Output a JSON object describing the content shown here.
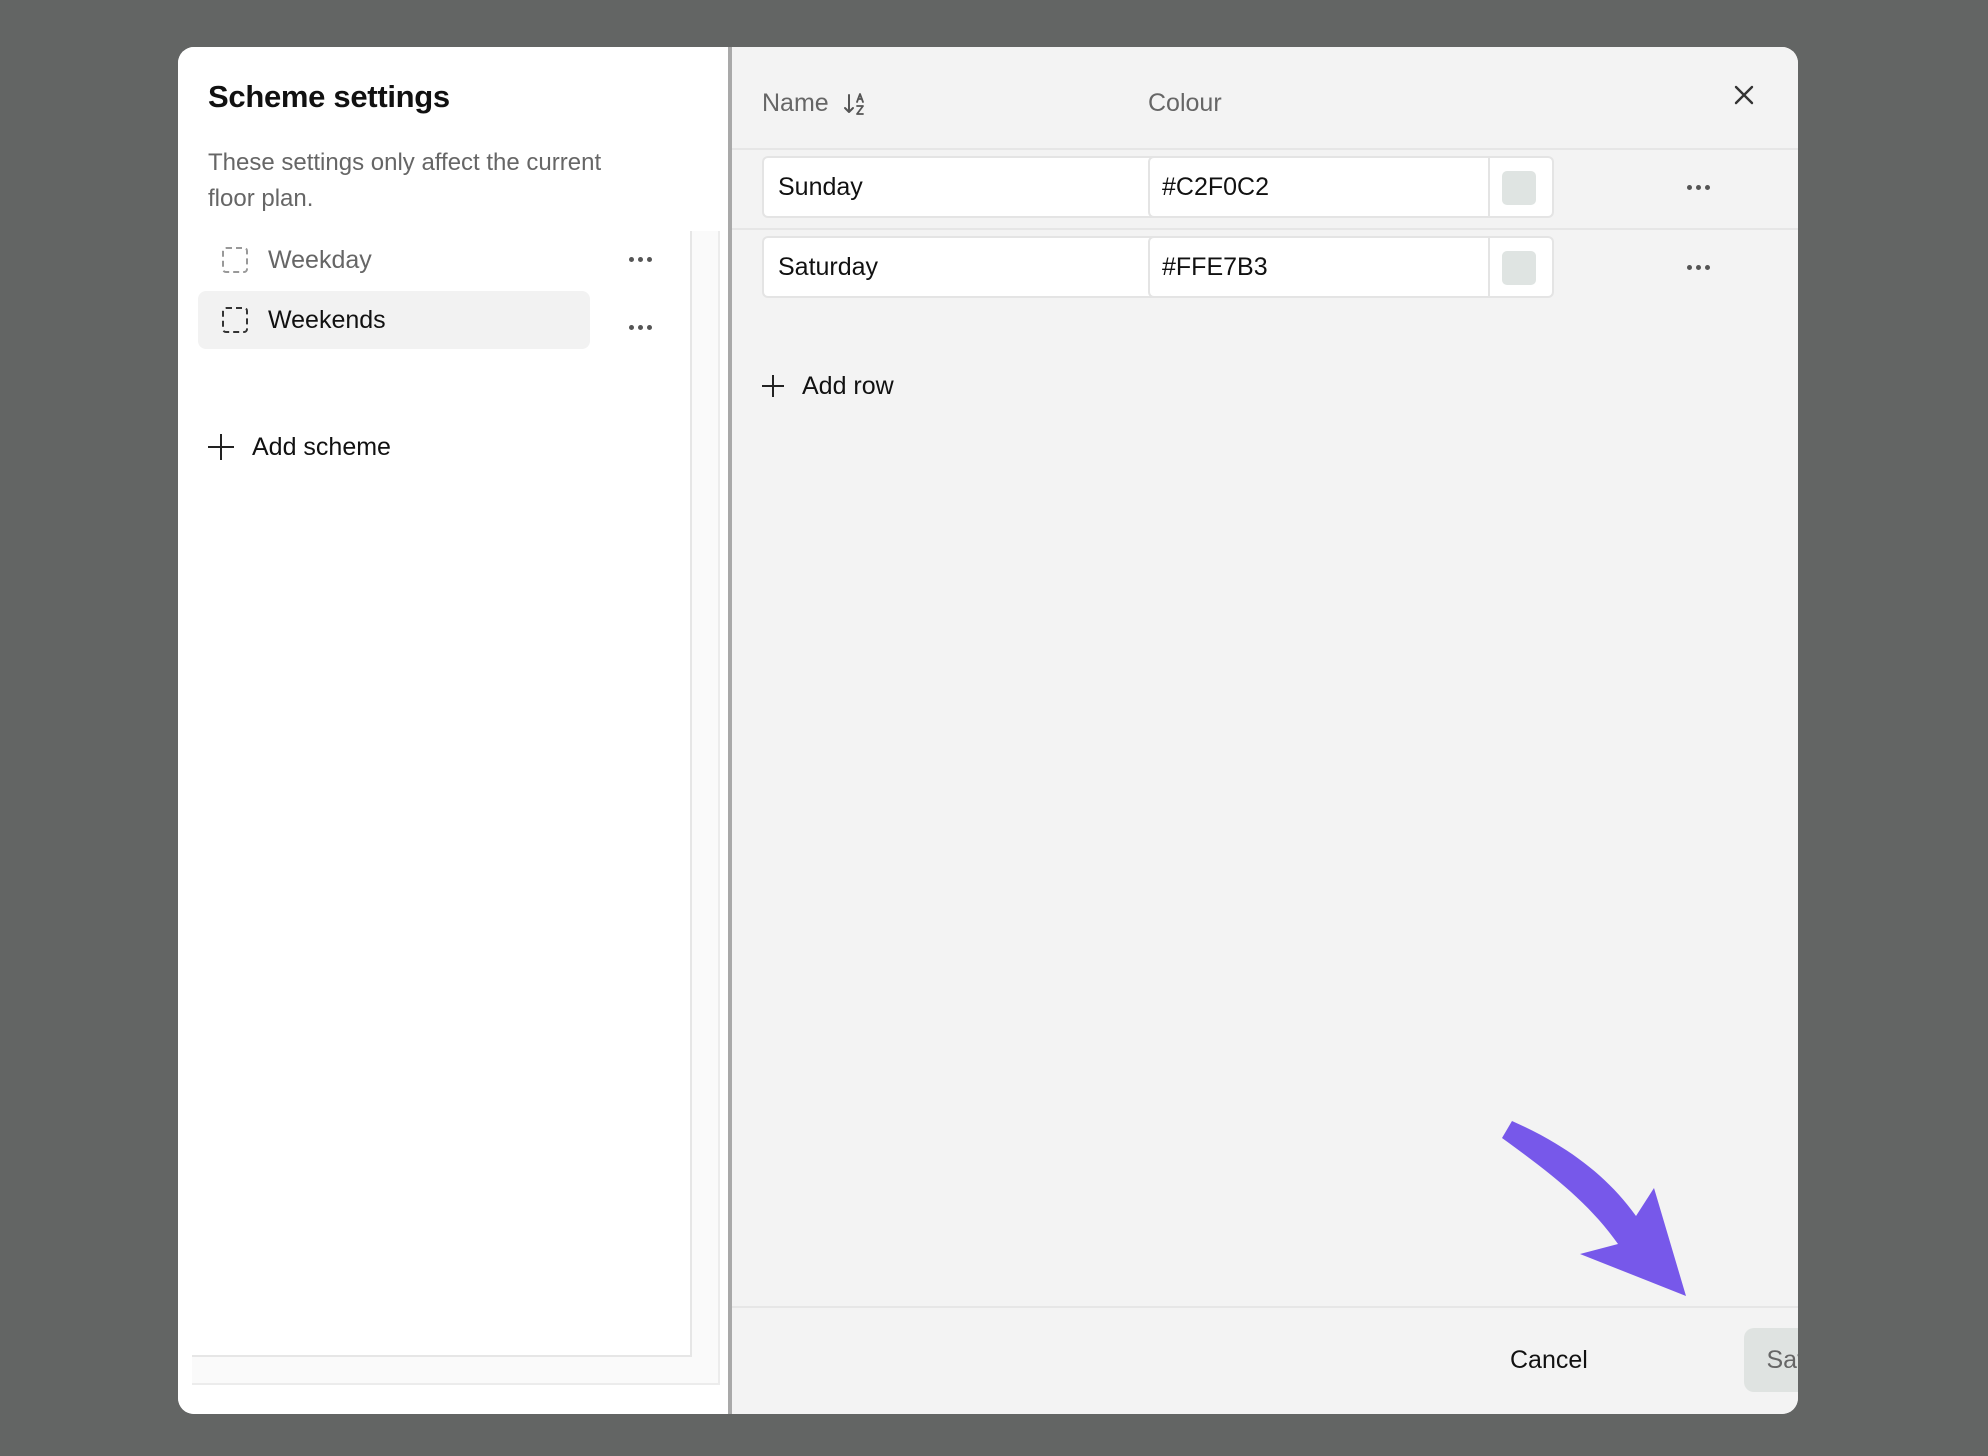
{
  "sidebar": {
    "title": "Scheme settings",
    "description": "These settings only affect the current floor plan.",
    "schemes": [
      {
        "label": "Weekday",
        "selected": false
      },
      {
        "label": "Weekends",
        "selected": true
      }
    ],
    "add_label": "Add scheme"
  },
  "table": {
    "headers": {
      "name": "Name",
      "colour": "Colour"
    },
    "rows": [
      {
        "name": "Sunday",
        "colour": "#C2F0C2"
      },
      {
        "name": "Saturday",
        "colour": "#FFE7B3"
      }
    ],
    "add_row_label": "Add row"
  },
  "footer": {
    "cancel_label": "Cancel",
    "save_label": "Save"
  },
  "colors": {
    "overlay": "#636564",
    "accent_arrow": "#7758EA",
    "panel_bg": "#F3F3F3",
    "swatch": "#DFE4E2"
  },
  "icons": [
    "dashed-square-icon",
    "more-dots-icon",
    "plus-icon",
    "sort-alpha-icon",
    "close-icon",
    "arrow-pointer-icon"
  ]
}
